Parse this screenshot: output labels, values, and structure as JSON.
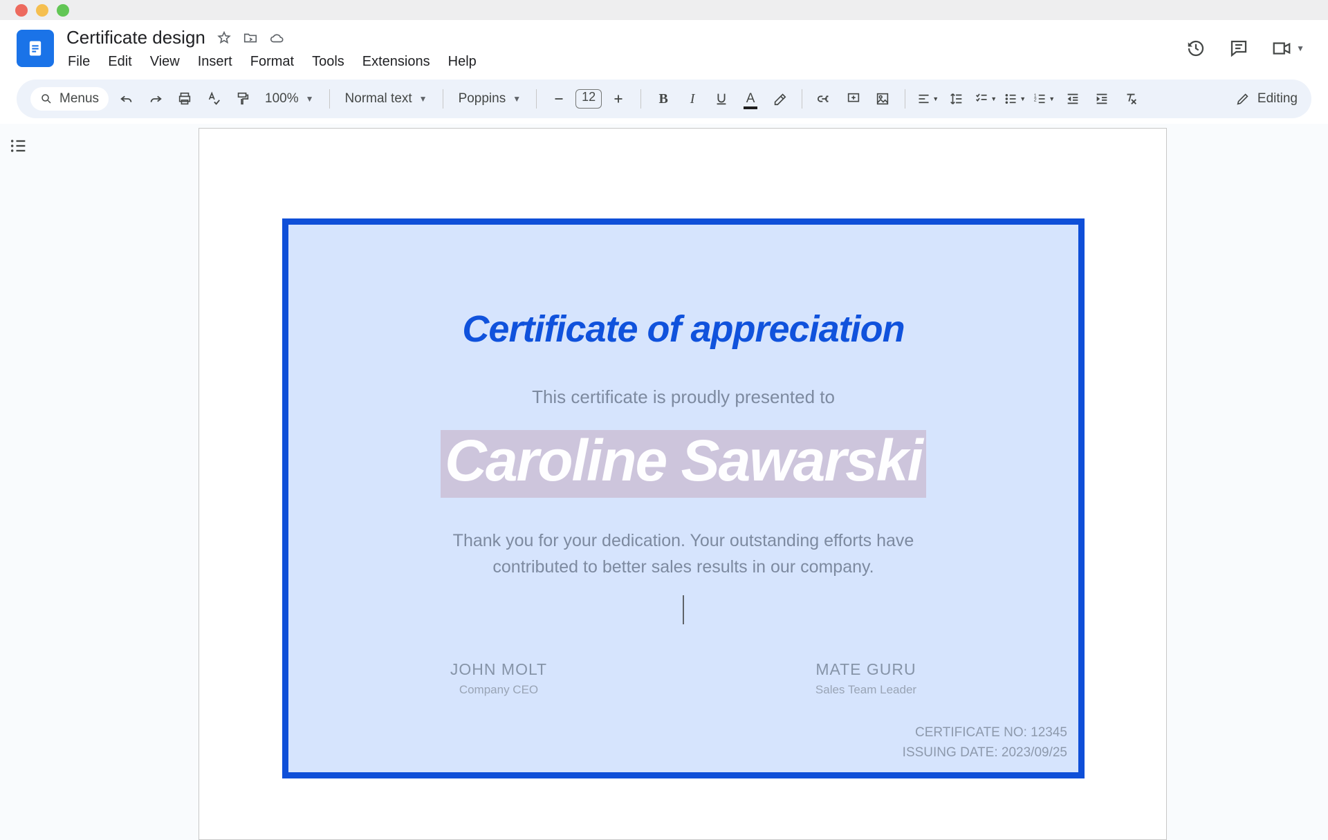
{
  "doc": {
    "title": "Certificate design"
  },
  "menu": {
    "file": "File",
    "edit": "Edit",
    "view": "View",
    "insert": "Insert",
    "format": "Format",
    "tools": "Tools",
    "extensions": "Extensions",
    "help": "Help"
  },
  "toolbar": {
    "menus_pill": "Menus",
    "zoom": "100%",
    "style": "Normal text",
    "font": "Poppins",
    "font_size": "12",
    "editing": "Editing"
  },
  "certificate": {
    "title": "Certificate of appreciation",
    "subtitle": "This certificate is proudly presented to",
    "recipient": "Caroline Sawarski",
    "body": "Thank you for your dedication. Your outstanding efforts have contributed to better sales results in our company.",
    "signer1_name": "JOHN MOLT",
    "signer1_title": "Company  CEO",
    "signer2_name": "MATE GURU",
    "signer2_title": "Sales Team Leader",
    "cert_no": "CERTIFICATE NO: 12345",
    "issue_date": "ISSUING DATE: 2023/09/25"
  }
}
